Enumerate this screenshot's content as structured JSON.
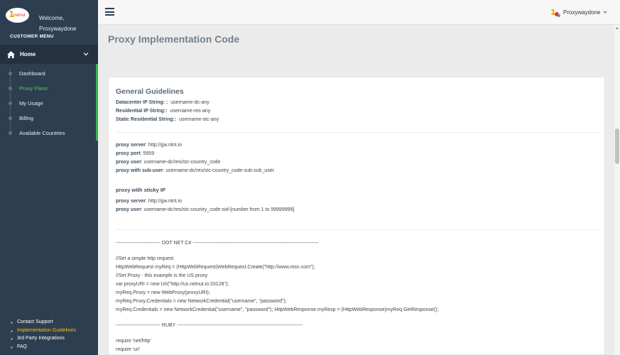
{
  "sidebar": {
    "welcome": "Welcome,",
    "username": "Proxywaydone",
    "menu_title": "CUSTOMER MENU",
    "home_label": "Home",
    "items": [
      {
        "label": "Dashboard",
        "active": false
      },
      {
        "label": "Proxy Plans",
        "active": true
      },
      {
        "label": "My Usage",
        "active": false
      },
      {
        "label": "Billing",
        "active": false
      },
      {
        "label": "Available Countries",
        "active": false
      }
    ],
    "bottom_links": [
      {
        "label": "Contact Support",
        "active": false
      },
      {
        "label": "Implementation Guidelines",
        "active": true
      },
      {
        "label": "3rd Party Integrations",
        "active": false
      },
      {
        "label": "FAQ",
        "active": false
      }
    ]
  },
  "topbar": {
    "user_name": "Proxywaydone"
  },
  "page": {
    "title": "Proxy Implementation Code"
  },
  "guidelines": {
    "title": "General Guidelines",
    "strings": [
      {
        "key": "Datacenter IP String: :",
        "value": "username-dc-any"
      },
      {
        "key": "Residential IP String::",
        "value": "username-res-any"
      },
      {
        "key": "Static Residential String::",
        "value": "username-stc-any"
      }
    ],
    "proxy": [
      {
        "key": "proxy server",
        "value": ":  http://gw.ntnt.io"
      },
      {
        "key": "proxy port",
        "value": ": 5959"
      },
      {
        "key": "proxy user",
        "value": ": username-dc/res/stc-country_code"
      },
      {
        "key": "proxy with sub-user",
        "value": ": username-dc/res/stc-country_code-sub-sub_user"
      }
    ],
    "sticky_title": "proxy with sticky IP",
    "sticky": [
      {
        "key": "proxy server",
        "value": ": http://gw.ntnt.io"
      },
      {
        "key": "proxy user",
        "value": ": username-dc/res/stc-country_code-sid-[number from 1 to 99999999]"
      }
    ]
  },
  "code": {
    "dotnet_header": "--------------------------- DOT NET C# ----------------------------------------------------------------------------",
    "dotnet_lines": [
      "//Set a simple http request",
      "HttpWebRequest myReq = (HttpWebRequest)WebRequest.Create(\"http://www.msn.com\");",
      "//Set Proxy - this example is the US proxy",
      "var proxyURI = new Uri(\"http://us.netnut.io:33128\");",
      "myReq.Proxy = new WebProxy(proxyURI);",
      "myReq.Proxy.Credentials = new NetworkCredential(\"username\", \"password\");",
      "myReq.Credentials = new NetworkCredential(\"username\", \"password\"); HttpWebResponse myResp = (HttpWebResponse)myReq.GetResponse();"
    ],
    "ruby_header": "--------------------------- RUBY ----------------------------------------------------------------------------",
    "ruby_lines": [
      "require 'net/http'",
      "require 'uri'"
    ]
  },
  "colors": {
    "sidebar_bg": "#2d3e50",
    "active_green": "#4cd04c",
    "active_yellow": "#f5c400"
  }
}
